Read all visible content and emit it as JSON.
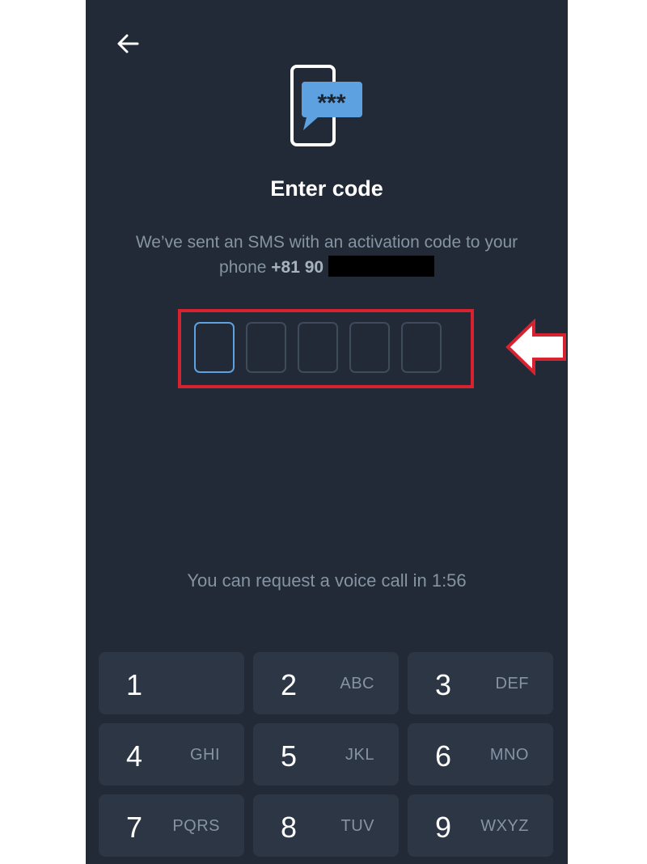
{
  "header": {
    "back_icon": "arrow-left-icon"
  },
  "hero": {
    "icon": "phone-sms-icon",
    "bubble_text": "***"
  },
  "title": "Enter code",
  "subtitle": {
    "line1": "We’ve sent an SMS with an activation code to your",
    "line2_prefix": "phone",
    "phone": "+81 90"
  },
  "code_input": {
    "length": 5,
    "active_index": 0
  },
  "hint": "You can request a voice call in 1:56",
  "keypad": [
    {
      "num": "1",
      "letters": ""
    },
    {
      "num": "2",
      "letters": "ABC"
    },
    {
      "num": "3",
      "letters": "DEF"
    },
    {
      "num": "4",
      "letters": "GHI"
    },
    {
      "num": "5",
      "letters": "JKL"
    },
    {
      "num": "6",
      "letters": "MNO"
    },
    {
      "num": "7",
      "letters": "PQRS"
    },
    {
      "num": "8",
      "letters": "TUV"
    },
    {
      "num": "9",
      "letters": "WXYZ"
    }
  ],
  "colors": {
    "background": "#212a36",
    "key": "#2c3645",
    "accent": "#5ea1e0",
    "annotation": "#d7232f"
  }
}
